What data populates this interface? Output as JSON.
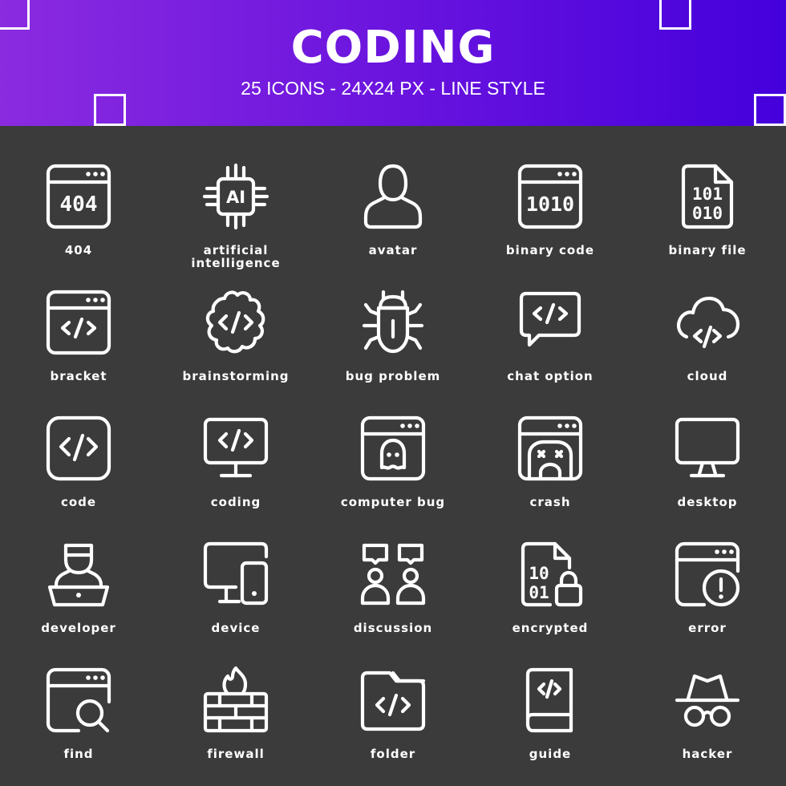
{
  "header": {
    "title": "CODING",
    "subtitle": "25 ICONS - 24X24 PX - LINE STYLE",
    "gradient_start": "#8b2be0",
    "gradient_end": "#4400dc"
  },
  "background_color": "#3b3b3b",
  "icon_color": "#ffffff",
  "icons": [
    {
      "label": "404",
      "icon": "404-window-icon"
    },
    {
      "label": "artificial intelligence",
      "line1": "artificial",
      "line2": "intelligence",
      "icon": "ai-chip-icon"
    },
    {
      "label": "avatar",
      "icon": "avatar-icon"
    },
    {
      "label": "binary code",
      "icon": "binary-code-window-icon"
    },
    {
      "label": "binary file",
      "icon": "binary-file-icon"
    },
    {
      "label": "bracket",
      "icon": "bracket-window-icon"
    },
    {
      "label": "brainstorming",
      "icon": "brain-code-icon"
    },
    {
      "label": "bug problem",
      "icon": "bug-icon"
    },
    {
      "label": "chat option",
      "icon": "chat-code-icon"
    },
    {
      "label": "cloud",
      "icon": "cloud-code-icon"
    },
    {
      "label": "code",
      "icon": "code-square-icon"
    },
    {
      "label": "coding",
      "icon": "monitor-code-icon"
    },
    {
      "label": "computer bug",
      "icon": "ghost-window-icon"
    },
    {
      "label": "crash",
      "icon": "crash-window-icon"
    },
    {
      "label": "desktop",
      "icon": "desktop-monitor-icon"
    },
    {
      "label": "developer",
      "icon": "developer-laptop-icon"
    },
    {
      "label": "device",
      "icon": "monitor-tablet-icon"
    },
    {
      "label": "discussion",
      "icon": "discussion-people-icon"
    },
    {
      "label": "encrypted",
      "icon": "encrypted-file-icon"
    },
    {
      "label": "error",
      "icon": "error-window-icon"
    },
    {
      "label": "find",
      "icon": "find-window-icon"
    },
    {
      "label": "firewall",
      "icon": "firewall-icon"
    },
    {
      "label": "folder",
      "icon": "code-folder-icon"
    },
    {
      "label": "guide",
      "icon": "code-book-icon"
    },
    {
      "label": "hacker",
      "icon": "hacker-hat-icon"
    }
  ],
  "glyphs": {
    "t404": "404",
    "ai": "AI",
    "bin1010": "1010",
    "bin101": "101",
    "bin010": "010",
    "enc10": "10",
    "enc01": "01"
  }
}
